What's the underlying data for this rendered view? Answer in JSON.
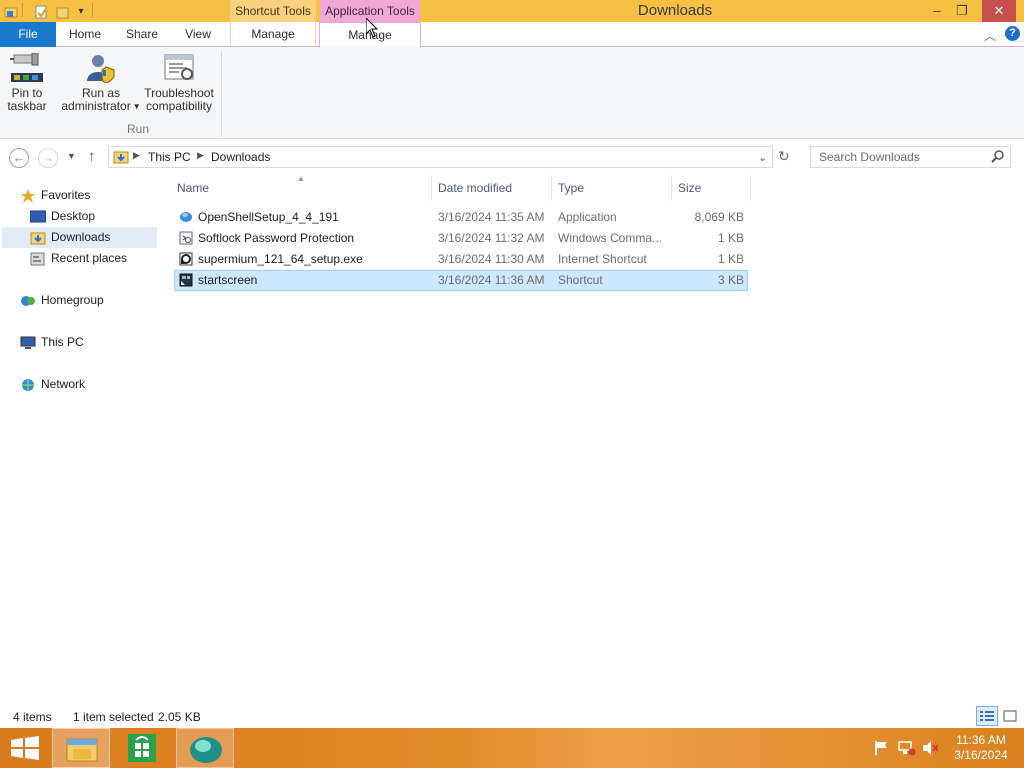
{
  "window": {
    "title": "Downloads",
    "context_tabs": [
      "Shortcut Tools",
      "Application Tools"
    ],
    "controls": {
      "minimize": "–",
      "restore": "❐",
      "close": "✕"
    }
  },
  "ribbon": {
    "tabs": [
      "File",
      "Home",
      "Share",
      "View",
      "Manage",
      "Manage"
    ],
    "buttons": {
      "pin": [
        "Pin to",
        "taskbar"
      ],
      "run_as": [
        "Run as",
        "administrator"
      ],
      "troubleshoot": [
        "Troubleshoot",
        "compatibility"
      ]
    },
    "group_label": "Run",
    "minimize_icon": "chevron-up-icon",
    "help_icon": "help-icon"
  },
  "address": {
    "breadcrumb": [
      "This PC",
      "Downloads"
    ],
    "search_placeholder": "Search Downloads"
  },
  "navpane": {
    "favorites": "Favorites",
    "items": [
      "Desktop",
      "Downloads",
      "Recent places"
    ],
    "homegroup": "Homegroup",
    "this_pc": "This PC",
    "network": "Network",
    "selected": "Downloads"
  },
  "columns": [
    "Name",
    "Date modified",
    "Type",
    "Size"
  ],
  "files": [
    {
      "name": "OpenShellSetup_4_4_191",
      "date": "3/16/2024 11:35 AM",
      "type": "Application",
      "size": "8,069 KB",
      "icon": "installer-icon"
    },
    {
      "name": "Softlock Password Protection",
      "date": "3/16/2024 11:32 AM",
      "type": "Windows Comma...",
      "size": "1 KB",
      "icon": "command-script-icon"
    },
    {
      "name": "supermium_121_64_setup.exe",
      "date": "3/16/2024 11:30 AM",
      "type": "Internet Shortcut",
      "size": "1 KB",
      "icon": "internet-shortcut-icon"
    },
    {
      "name": "startscreen",
      "date": "3/16/2024 11:36 AM",
      "type": "Shortcut",
      "size": "3 KB",
      "icon": "shortcut-icon",
      "selected": true
    }
  ],
  "status": {
    "count": "4 items",
    "selection": "1 item selected",
    "size": "2.05 KB"
  },
  "taskbar": {
    "time": "11:36 AM",
    "date": "3/16/2024",
    "apps": [
      "file-explorer-icon",
      "store-icon",
      "open-shell-icon"
    ]
  },
  "colors": {
    "titlebar": "#f6c142",
    "file_tab": "#1979ca",
    "selection": "#cce8ff",
    "taskbar": "#e18a2b"
  }
}
